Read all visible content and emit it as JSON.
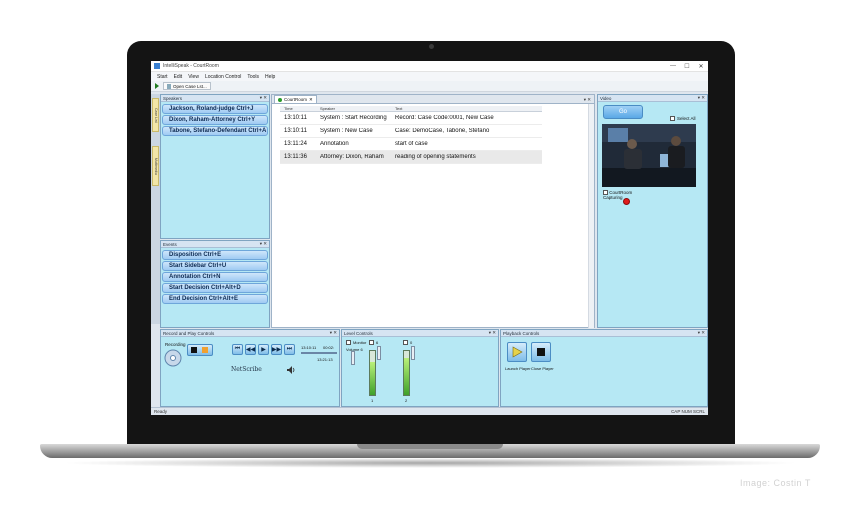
{
  "app": {
    "title": "IntelliSpeak - CourtRoom",
    "window_controls": [
      "—",
      "☐",
      "✕"
    ]
  },
  "menu": [
    "Start",
    "Edit",
    "View",
    "Location Control",
    "Tools",
    "Help"
  ],
  "toolbar": {
    "open_case_label": "Open Case Lst..."
  },
  "side_tabs": [
    "Case List",
    "Multimedia"
  ],
  "speakers": {
    "title": "Speakers",
    "controls": "▾ ✕",
    "items": [
      "Jackson, Roland-judge Ctrl+J",
      "Dixon, Raham-Attorney Ctrl+Y",
      "Tabone, Stefano-Defendant Ctrl+A"
    ]
  },
  "events": {
    "title": "Events",
    "controls": "▾ ✕",
    "items": [
      "Disposition Ctrl+E",
      "Start Sidebar Ctrl+U",
      "Annotation Ctrl+N",
      "Start Decision Ctrl+Alt+D",
      "End Decision Ctrl+Alt+E"
    ]
  },
  "courtroom": {
    "tab_label": "CourtRoom",
    "tab_close": "✕",
    "controls": "▾ ✕",
    "columns": [
      "Time",
      "Speaker",
      "Text"
    ],
    "rows": [
      {
        "time": "13:10:11",
        "speaker": "System : Start Recording",
        "text": "Record: Case Code:0001, New Case",
        "highlight": false
      },
      {
        "time": "13:10:11",
        "speaker": "System : New Case",
        "text": "Case: DemoCase, Tabone, Stefano",
        "highlight": false
      },
      {
        "time": "13:11:24",
        "speaker": "Annotation",
        "text": "start of case",
        "highlight": false
      },
      {
        "time": "13:11:36",
        "speaker": "Attorney: Dixon, Raham",
        "text": "reading of opening statements",
        "highlight": true
      }
    ]
  },
  "video": {
    "title": "Video",
    "controls": "▾ ✕",
    "button_label": "Go",
    "select_all_label": "Select All",
    "capture_label": "CourtRoom",
    "capture_status": "Capturing"
  },
  "record_controls": {
    "title": "Record and Play Controls",
    "controls": "▾ ✕",
    "recording_label": "Recording",
    "time_start": "13:10:11",
    "time_current": "00:02:",
    "time_end": "13:10:11",
    "time_end2": "13:21:13",
    "logo_text": "NetScribe",
    "transport": [
      "⏮",
      "◀◀",
      "▶",
      "▶▶",
      "⏭"
    ]
  },
  "level_controls": {
    "title": "Level Controls",
    "controls": "▾ ✕",
    "monitor_label": "Monitor",
    "volume_label": "Volume",
    "volume_value": "6",
    "channel1_value": "6",
    "channel2_value": "0",
    "channel_labels": [
      "1",
      "2"
    ],
    "levels": [
      0.75,
      0.85
    ]
  },
  "playback_controls": {
    "title": "Playback Controls",
    "controls": "▾ ✕",
    "launch_label": "Launch Player",
    "close_label": "Close Player"
  },
  "status": {
    "left": "Ready",
    "right": "CAP  NUM  SCRL"
  },
  "watermark": "Image: Costin T"
}
